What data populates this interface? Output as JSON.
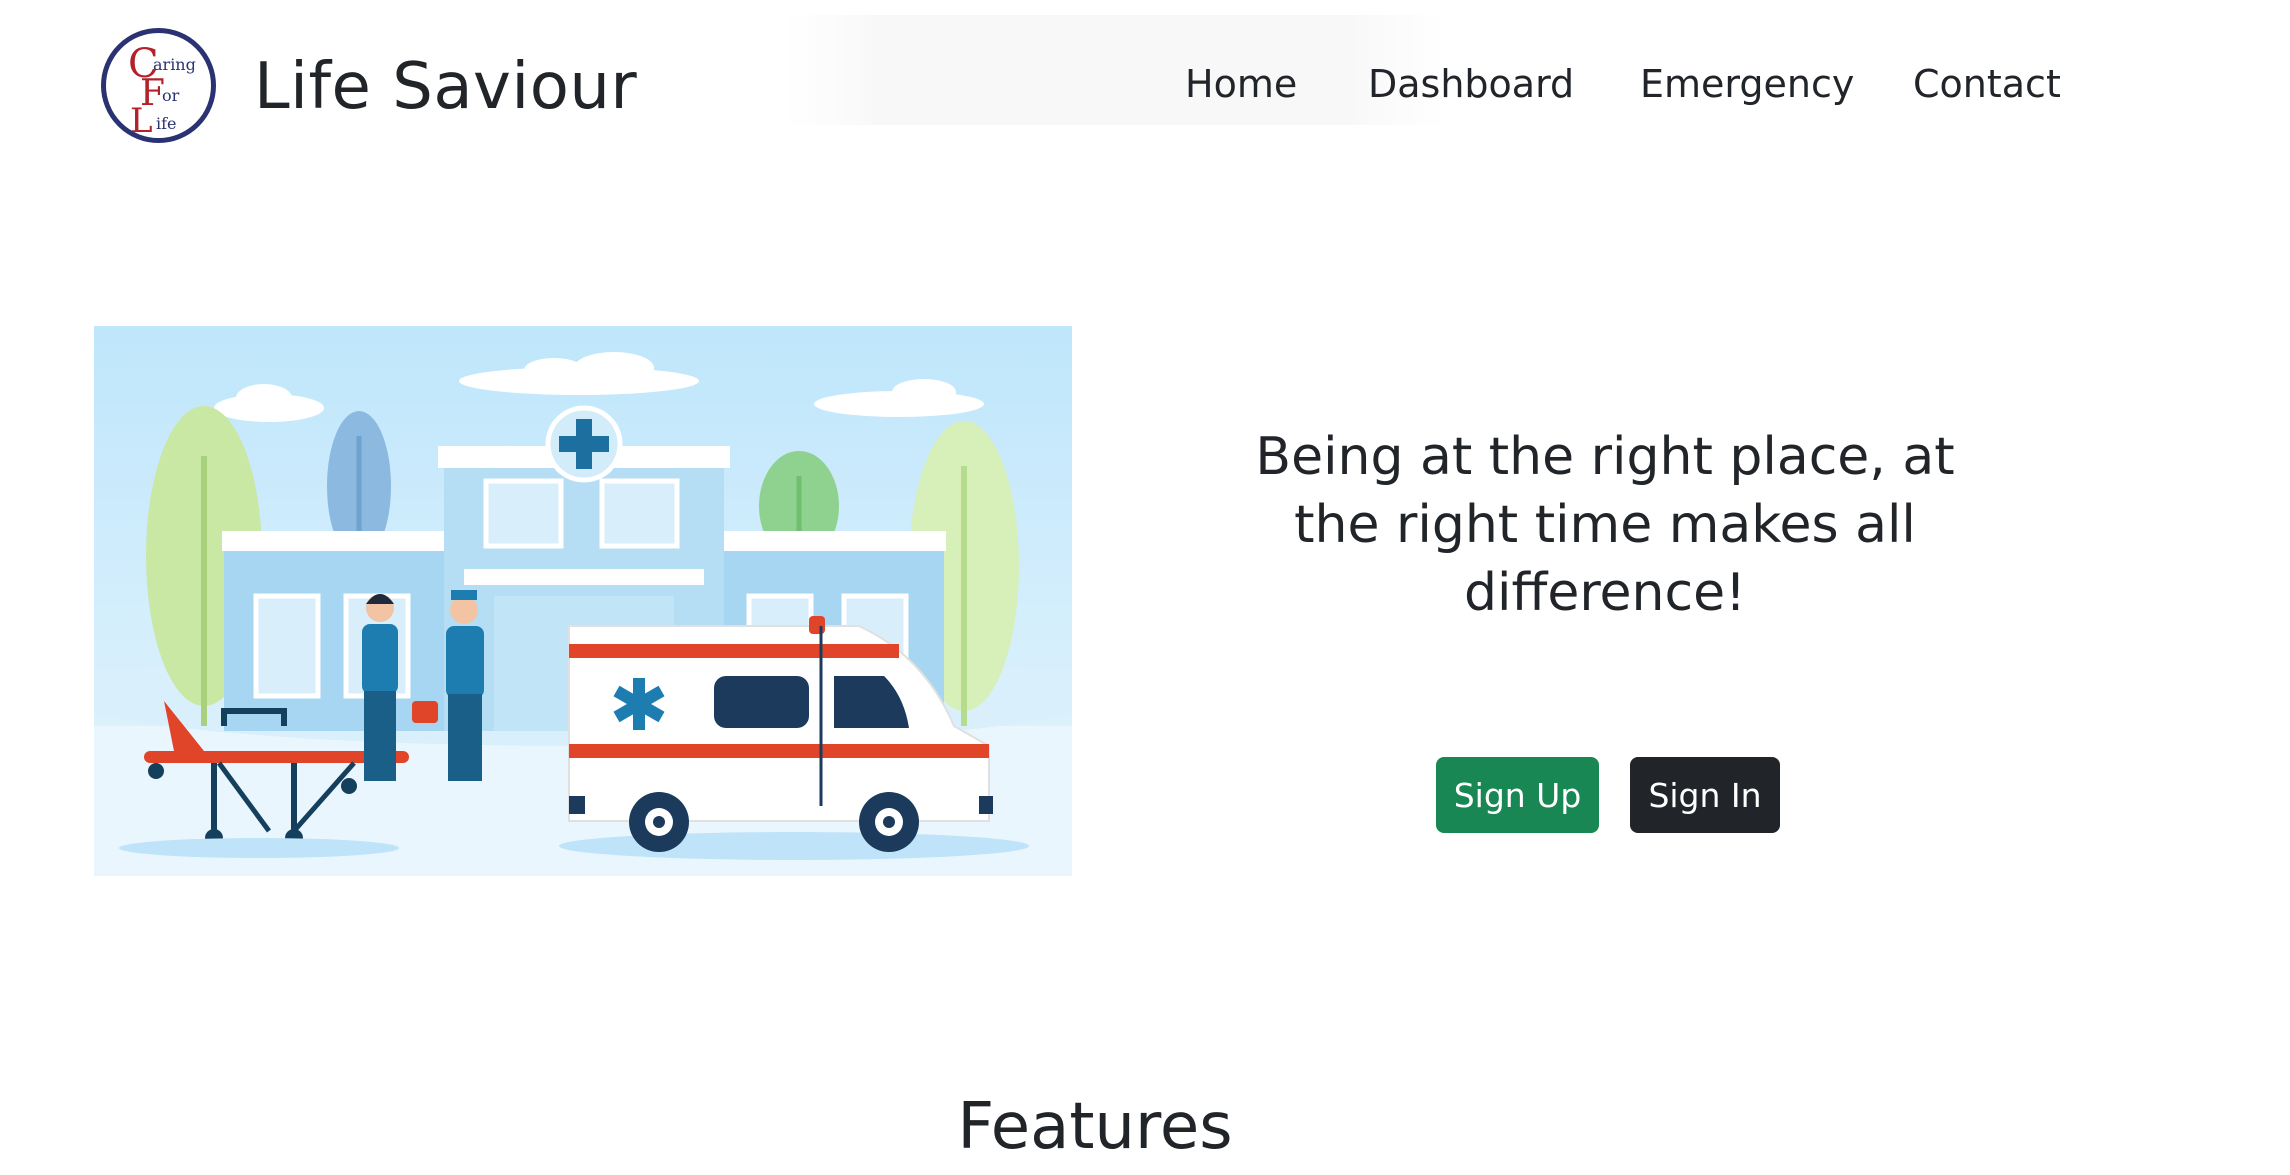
{
  "header": {
    "brand": "Life Saviour",
    "logo": {
      "letters": [
        "C",
        "F",
        "L"
      ],
      "words": [
        "aring",
        "or",
        "ife"
      ],
      "ring_color": "#2b3272",
      "letter_color": "#b3212b"
    }
  },
  "nav": {
    "items": [
      "Home",
      "Dashboard",
      "Emergency",
      "Contact"
    ]
  },
  "hero": {
    "headline": "Being at the right place, at the right time makes all difference!",
    "illustration": "hospital-ambulance-illustration",
    "buttons": {
      "signup": "Sign Up",
      "signin": "Sign In"
    }
  },
  "colors": {
    "primary_text": "#212529",
    "success": "#198754",
    "dark": "#212529",
    "sky": "#d6eefa",
    "ambulance_red": "#e0452a"
  },
  "features": {
    "title": "Features"
  }
}
